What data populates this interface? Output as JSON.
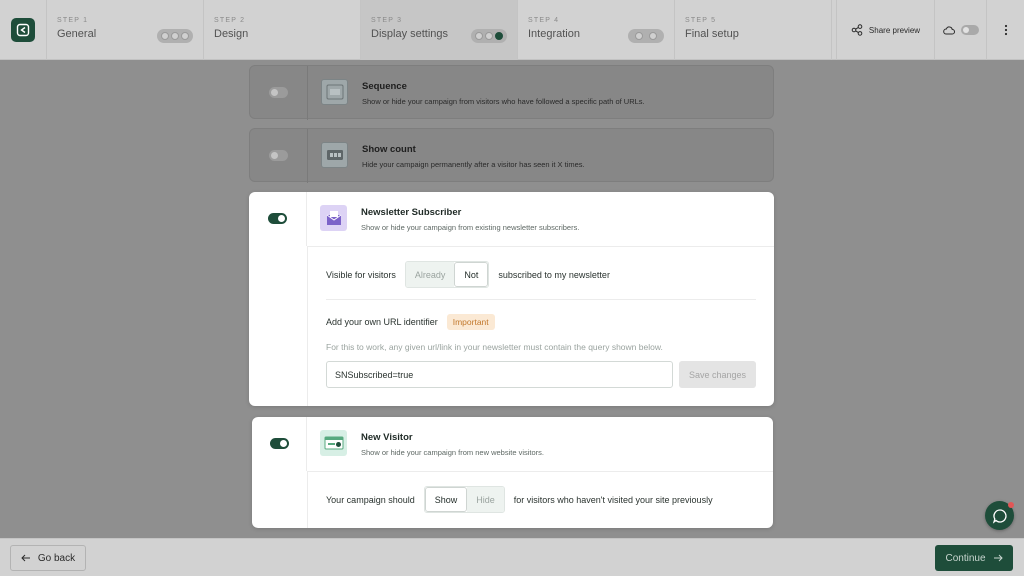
{
  "steps": [
    {
      "num": "STEP 1",
      "name": "General"
    },
    {
      "num": "STEP 2",
      "name": "Design"
    },
    {
      "num": "STEP 3",
      "name": "Display settings"
    },
    {
      "num": "STEP 4",
      "name": "Integration"
    },
    {
      "num": "STEP 5",
      "name": "Final setup"
    }
  ],
  "header": {
    "share_label": "Share preview"
  },
  "cards": {
    "sequence": {
      "title": "Sequence",
      "desc": "Show or hide your campaign from visitors who have followed a specific path of URLs.",
      "enabled": false
    },
    "show_count": {
      "title": "Show count",
      "desc": "Hide your campaign permanently after a visitor has seen it X times.",
      "enabled": false
    },
    "newsletter": {
      "title": "Newsletter Subscriber",
      "desc": "Show or hide your campaign from existing newsletter subscribers.",
      "enabled": true,
      "visible_label": "Visible for visitors",
      "option_already": "Already",
      "option_not": "Not",
      "selected": "Not",
      "visible_suffix": "subscribed to my newsletter",
      "url_label": "Add your own URL identifier",
      "badge": "Important",
      "help": "For this to work, any given url/link in your newsletter must contain the query shown below.",
      "input_value": "SNSubscribed=true",
      "save_label": "Save changes"
    },
    "new_visitor": {
      "title": "New Visitor",
      "desc": "Show or hide your campaign from new website visitors.",
      "enabled": true,
      "prefix": "Your campaign should",
      "option_show": "Show",
      "option_hide": "Hide",
      "selected": "Show",
      "suffix": "for visitors who haven't visited your site previously"
    }
  },
  "footer": {
    "back_label": "Go back",
    "continue_label": "Continue"
  },
  "colors": {
    "brand": "#1e4d3a",
    "badge_bg": "#fbe9d4",
    "badge_text": "#c2782c"
  }
}
